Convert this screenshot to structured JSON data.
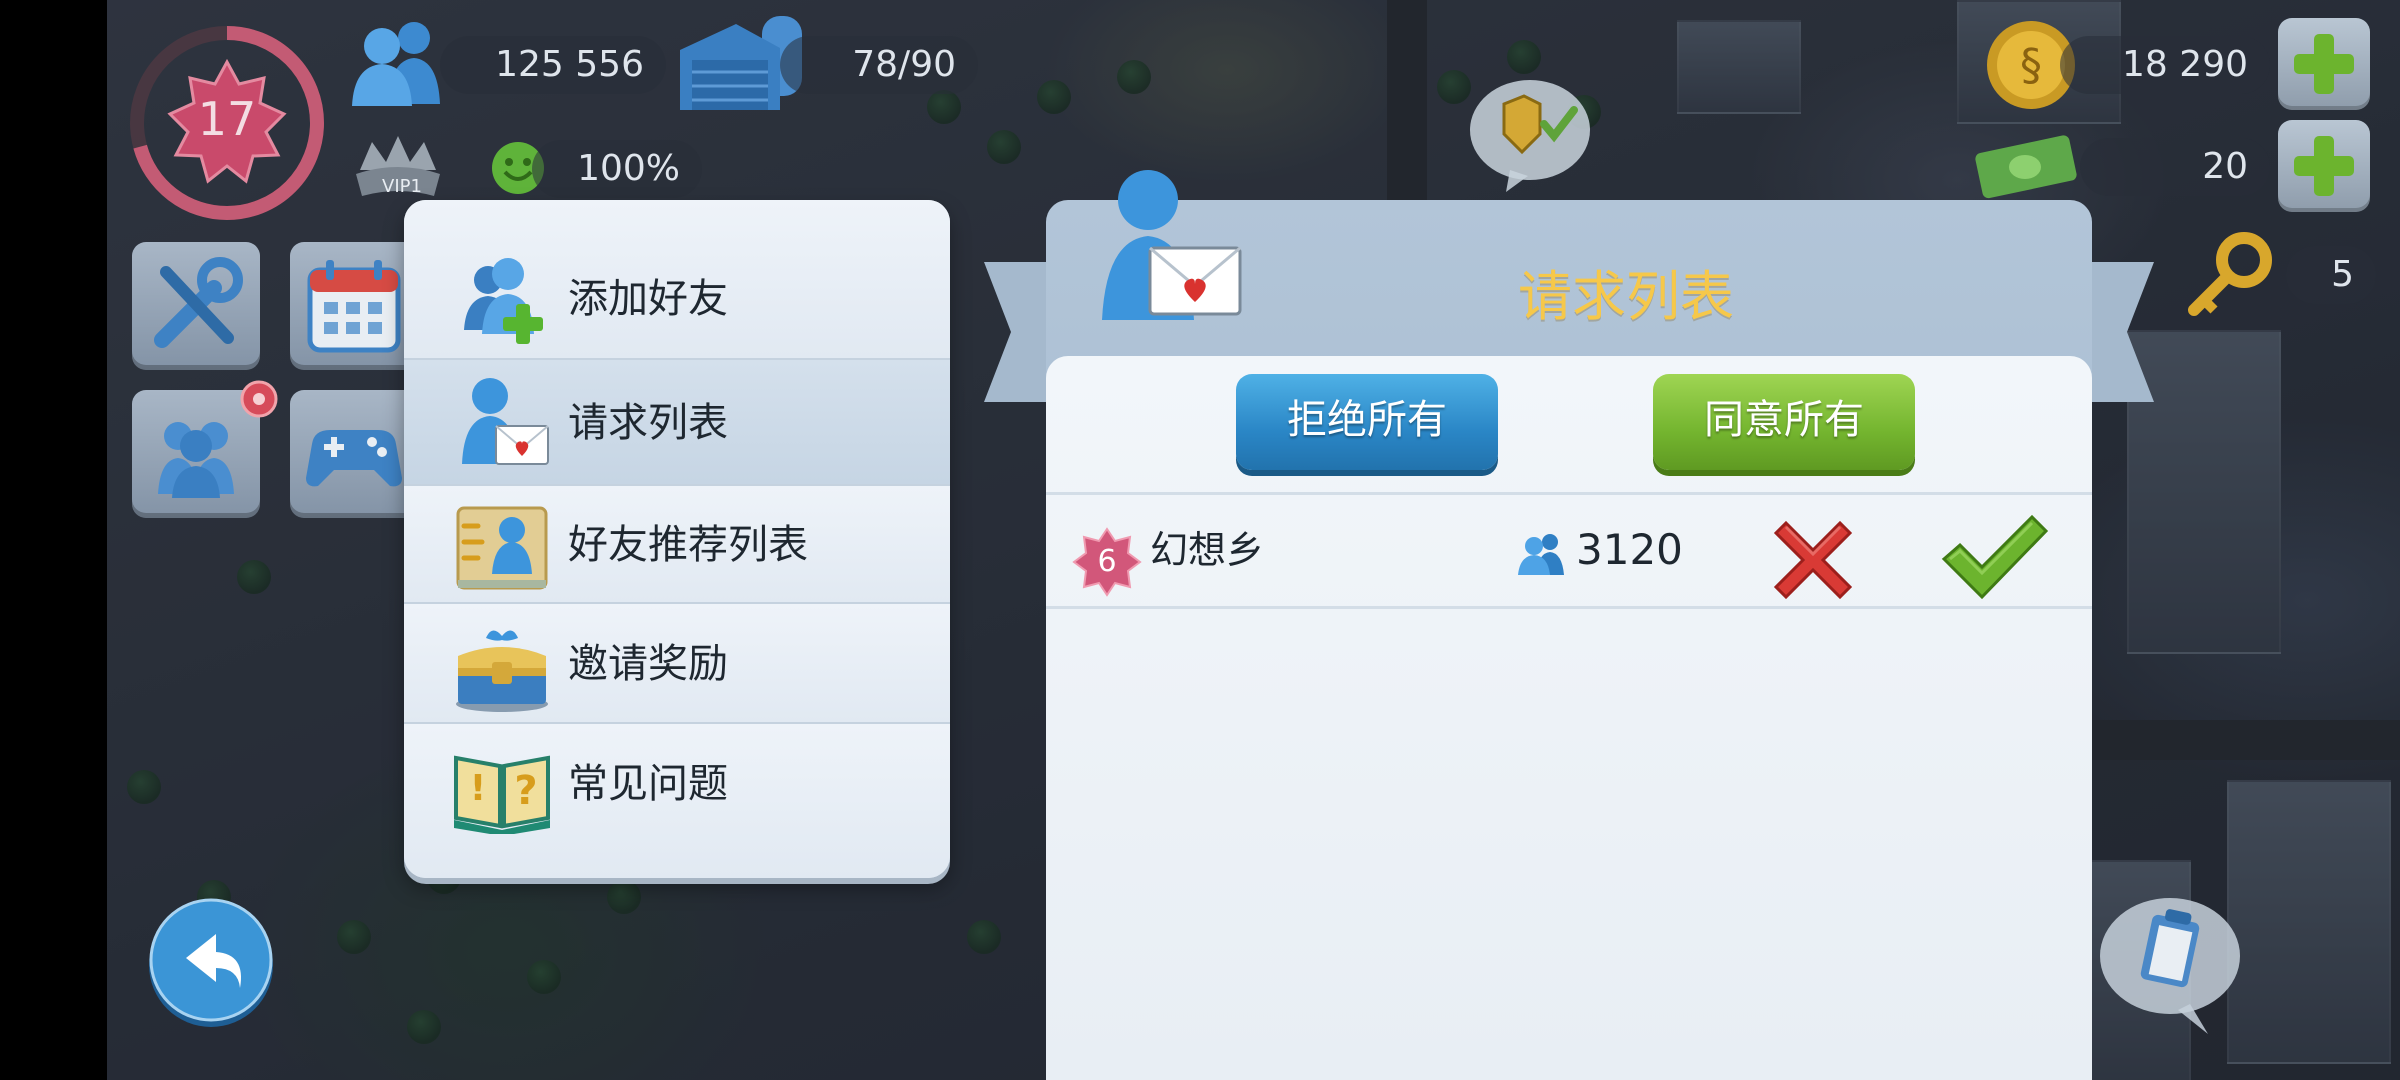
{
  "hud": {
    "level": "17",
    "vip_label": "VIP1",
    "population": "125 556",
    "storage": "78/90",
    "happiness": "100%",
    "simoleons": "18 290",
    "simcash": "20",
    "keys": "5"
  },
  "menu": {
    "items": [
      {
        "label": "添加好友",
        "icon": "add-friend-icon"
      },
      {
        "label": "请求列表",
        "icon": "request-list-icon"
      },
      {
        "label": "好友推荐列表",
        "icon": "friend-recommend-icon"
      },
      {
        "label": "邀请奖励",
        "icon": "invite-reward-chest-icon"
      },
      {
        "label": "常见问题",
        "icon": "faq-book-icon"
      }
    ],
    "active_index": 1
  },
  "request_panel": {
    "title": "请求列表",
    "reject_all_label": "拒绝所有",
    "accept_all_label": "同意所有",
    "requests": [
      {
        "level": "6",
        "name": "幻想乡",
        "population": "3120"
      }
    ]
  },
  "colors": {
    "title_gold": "#f6c84a",
    "reject_blue": "#2a86c6",
    "accept_green": "#74b52f",
    "reject_red": "#d93a35",
    "level_badge_pink": "#d2577a"
  }
}
